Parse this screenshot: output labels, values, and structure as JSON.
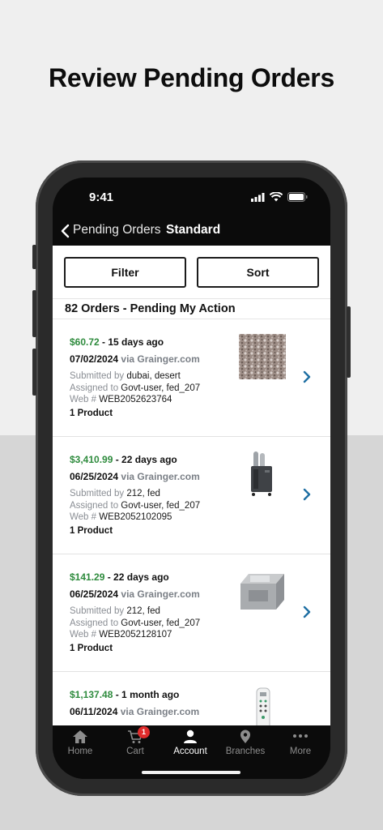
{
  "headline": "Review Pending Orders",
  "status_bar": {
    "time": "9:41"
  },
  "nav": {
    "back_label": "Pending Orders",
    "title": "Standard"
  },
  "actions": {
    "filter_label": "Filter",
    "sort_label": "Sort"
  },
  "orders_count": "82 Orders - Pending My Action",
  "orders": [
    {
      "price": "$60.72",
      "age": " - 15 days ago",
      "date": "07/02/2024",
      "via": " via Grainger.com",
      "submitted_key": "Submitted by",
      "submitted_val": " dubai, desert",
      "assigned_key": "Assigned to",
      "assigned_val": " Govt-user, fed_207",
      "web_key": "Web #",
      "web_val": " WEB2052623764",
      "products": "1 Product",
      "thumb": "granular-material-image"
    },
    {
      "price": "$3,410.99",
      "age": " - 22 days ago",
      "date": "06/25/2024",
      "via": " via Grainger.com",
      "submitted_key": "Submitted by",
      "submitted_val": " 212, fed",
      "assigned_key": "Assigned to",
      "assigned_val": " Govt-user, fed_207",
      "web_key": "Web #",
      "web_val": " WEB2052102095",
      "products": "1 Product",
      "thumb": "portable-air-conditioner-image"
    },
    {
      "price": "$141.29",
      "age": " - 22 days ago",
      "date": "06/25/2024",
      "via": " via Grainger.com",
      "submitted_key": "Submitted by",
      "submitted_val": " 212, fed",
      "assigned_key": "Assigned to",
      "assigned_val": " Govt-user, fed_207",
      "web_key": "Web #",
      "web_val": " WEB2052128107",
      "products": "1 Product",
      "thumb": "test-weight-image"
    },
    {
      "price": "$1,137.48",
      "age": " - 1 month ago",
      "date": "06/11/2024",
      "via": " via Grainger.com",
      "thumb": "remote-control-image"
    }
  ],
  "tabs": [
    {
      "label": "Home",
      "icon": "home-icon"
    },
    {
      "label": "Cart",
      "icon": "cart-icon",
      "badge": "1"
    },
    {
      "label": "Account",
      "icon": "account-icon",
      "active": true
    },
    {
      "label": "Branches",
      "icon": "location-pin-icon"
    },
    {
      "label": "More",
      "icon": "more-dots-icon"
    }
  ],
  "colors": {
    "price_green": "#2e8b3d",
    "chevron_blue": "#1f6fa3",
    "badge_red": "#e02b2b"
  }
}
